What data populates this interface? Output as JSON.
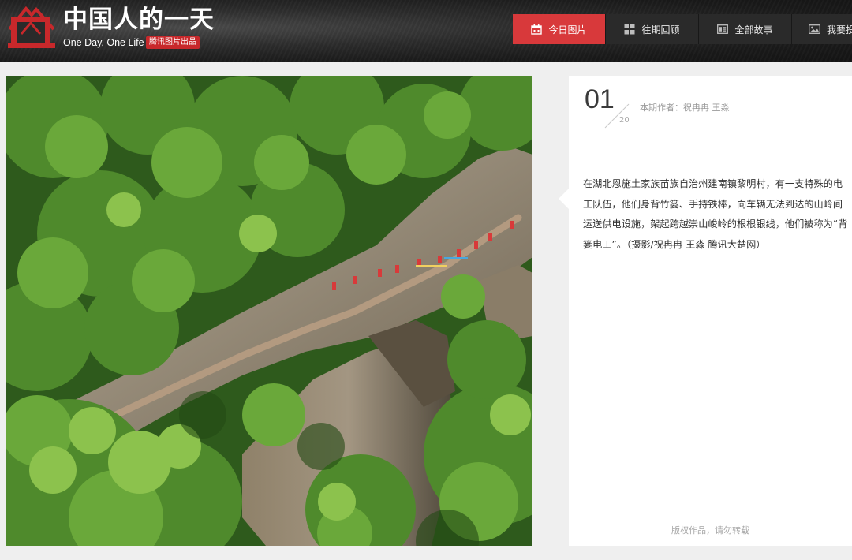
{
  "header": {
    "title": "中国人的一天",
    "subtitle": "One Day, One Life",
    "badge": "腾讯图片出品"
  },
  "nav": {
    "items": [
      {
        "label": "今日图片",
        "icon": "calendar-icon",
        "active": true
      },
      {
        "label": "往期回顾",
        "icon": "grid-icon",
        "active": false
      },
      {
        "label": "全部故事",
        "icon": "list-icon",
        "active": false
      },
      {
        "label": "我要投",
        "icon": "image-icon",
        "active": false
      }
    ]
  },
  "photo": {
    "alt": "aerial view of workers walking along cliff path"
  },
  "panel": {
    "page_current": "01",
    "page_total": "20",
    "author": "本期作者：祝冉冉 王淼",
    "description": "在湖北恩施土家族苗族自治州建南镇黎明村，有一支特殊的电工队伍，他们身背竹篓、手持铁棒，向车辆无法到达的山岭间运送供电设施，架起跨越崇山峻岭的根根银线，他们被称为“背篓电工”。（摄影/祝冉冉 王淼 腾讯大楚网）",
    "copyright": "版权作品，请勿转载"
  },
  "colors": {
    "accent": "#d8393b",
    "header_bg": "#1e1e1e",
    "page_bg": "#efefef"
  }
}
